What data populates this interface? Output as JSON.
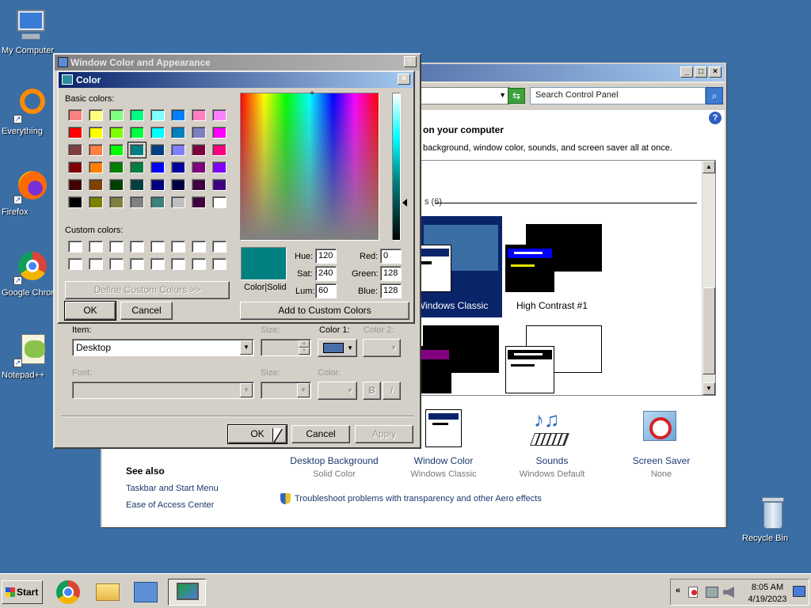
{
  "desktop": {
    "icons": [
      {
        "label": "My Computer"
      },
      {
        "label": "Everything"
      },
      {
        "label": "Firefox"
      },
      {
        "label": "Google Chrome"
      },
      {
        "label": "Notepad++"
      },
      {
        "label": "Recycle Bin"
      }
    ]
  },
  "control_panel": {
    "search_placeholder": "Search Control Panel",
    "heading": "on your computer",
    "description": "background, window color, sounds, and screen saver all at once.",
    "themes_group": "s (6)",
    "themes": [
      {
        "name": "Windows Classic",
        "selected": true
      },
      {
        "name": "High Contrast #1",
        "selected": false
      }
    ],
    "tiles": [
      {
        "title": "Desktop Background",
        "subtitle": "Solid Color"
      },
      {
        "title": "Window Color",
        "subtitle": "Windows Classic"
      },
      {
        "title": "Sounds",
        "subtitle": "Windows Default"
      },
      {
        "title": "Screen Saver",
        "subtitle": "None"
      }
    ],
    "see_also": "See also",
    "links": [
      "Taskbar and Start Menu",
      "Ease of Access Center"
    ],
    "troubleshoot": "Troubleshoot problems with transparency and other Aero effects"
  },
  "appearance_dialog": {
    "title": "Window Color and Appearance",
    "item_label": "Item:",
    "item_value": "Desktop",
    "size_label": "Size:",
    "color1_label": "Color 1:",
    "color1_value": "#4a6ea9",
    "color2_label": "Color 2:",
    "font_label": "Font:",
    "font_size_label": "Size:",
    "font_color_label": "Color:",
    "bold_label": "B",
    "italic_label": "I",
    "ok_label": "OK",
    "cancel_label": "Cancel",
    "apply_label": "Apply"
  },
  "color_dialog": {
    "title": "Color",
    "basic_colors_label": "Basic colors:",
    "custom_colors_label": "Custom colors:",
    "define_custom_label": "Define Custom Colors >>",
    "ok_label": "OK",
    "cancel_label": "Cancel",
    "add_custom_label": "Add to Custom Colors",
    "color_solid_label": "Color|Solid",
    "hue_label": "Hue:",
    "hue": "120",
    "sat_label": "Sat:",
    "sat": "240",
    "lum_label": "Lum:",
    "lum": "60",
    "red_label": "Red:",
    "red": "0",
    "green_label": "Green:",
    "green": "128",
    "blue_label": "Blue:",
    "blue": "128",
    "selected_swatch": 19,
    "basic_colors": [
      "#ff8080",
      "#ffff80",
      "#80ff80",
      "#00ff80",
      "#80ffff",
      "#0080ff",
      "#ff80c0",
      "#ff80ff",
      "#ff0000",
      "#ffff00",
      "#80ff00",
      "#00ff40",
      "#00ffff",
      "#0080c0",
      "#8080c0",
      "#ff00ff",
      "#804040",
      "#ff8040",
      "#00ff00",
      "#008080",
      "#004080",
      "#8080ff",
      "#800040",
      "#ff0080",
      "#800000",
      "#ff8000",
      "#008000",
      "#008040",
      "#0000ff",
      "#0000a0",
      "#800080",
      "#8000ff",
      "#400000",
      "#804000",
      "#004000",
      "#004040",
      "#000080",
      "#000040",
      "#400040",
      "#400080",
      "#000000",
      "#808000",
      "#808040",
      "#808080",
      "#408080",
      "#c0c0c0",
      "#400040",
      "#ffffff"
    ]
  },
  "taskbar": {
    "start_label": "Start",
    "time": "8:05 AM",
    "date": "4/19/2023"
  }
}
